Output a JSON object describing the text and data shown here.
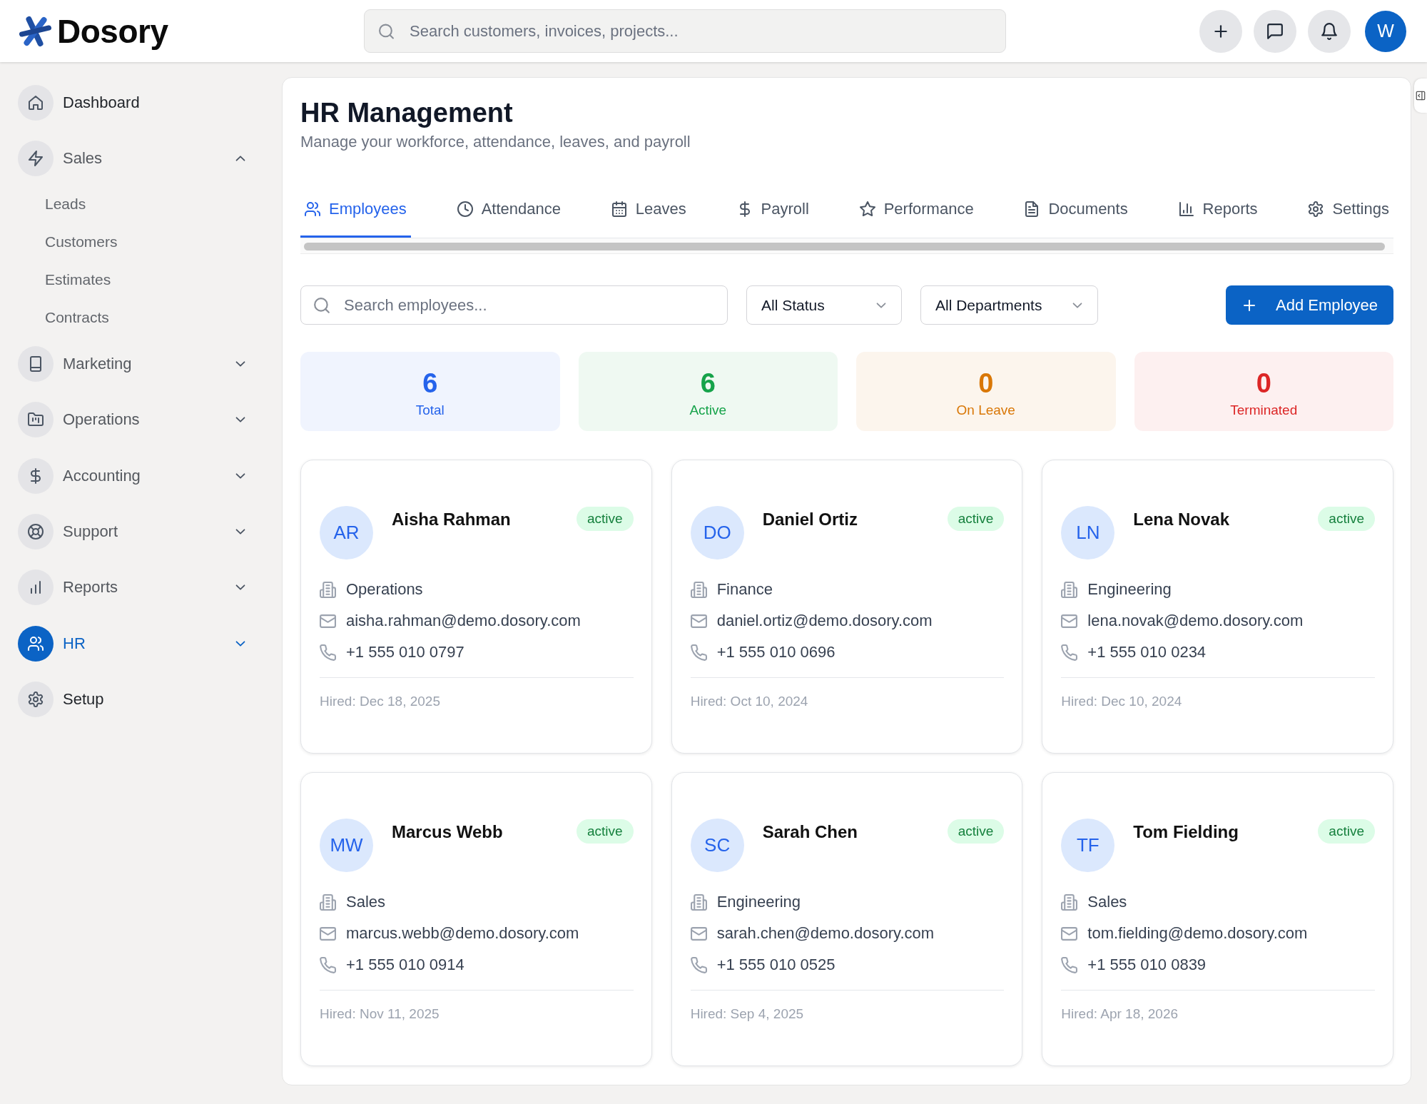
{
  "header": {
    "logo": "Dosory",
    "search": {
      "placeholder": "Search customers, invoices, projects..."
    },
    "user_avatar": "W"
  },
  "sidebar": {
    "items": [
      {
        "kind": "link",
        "label": "Dashboard",
        "selected": false
      },
      {
        "kind": "group",
        "label": "Sales",
        "selected": false,
        "expanded": true,
        "children": [
          {
            "label": "Leads",
            "selected": false
          },
          {
            "label": "Customers",
            "selected": false
          },
          {
            "label": "Estimates",
            "selected": false
          },
          {
            "label": "Contracts",
            "selected": false
          }
        ]
      },
      {
        "kind": "group",
        "label": "Marketing",
        "selected": false,
        "expanded": false
      },
      {
        "kind": "group",
        "label": "Operations",
        "selected": false,
        "expanded": false
      },
      {
        "kind": "group",
        "label": "Accounting",
        "selected": false,
        "expanded": false
      },
      {
        "kind": "group",
        "label": "Support",
        "selected": false,
        "expanded": false
      },
      {
        "kind": "group",
        "label": "Reports",
        "selected": false,
        "expanded": false
      },
      {
        "kind": "group",
        "label": "HR",
        "selected": true,
        "expanded": false
      },
      {
        "kind": "link",
        "label": "Setup",
        "selected": false
      }
    ]
  },
  "page": {
    "title": "HR Management",
    "subtitle": "Manage your workforce, attendance, leaves, and payroll"
  },
  "tabs": [
    {
      "label": "Employees",
      "selected": true
    },
    {
      "label": "Attendance",
      "selected": false
    },
    {
      "label": "Leaves",
      "selected": false
    },
    {
      "label": "Payroll",
      "selected": false
    },
    {
      "label": "Performance",
      "selected": false
    },
    {
      "label": "Documents",
      "selected": false
    },
    {
      "label": "Reports",
      "selected": false
    },
    {
      "label": "Settings",
      "selected": false
    }
  ],
  "filters": {
    "search": {
      "placeholder": "Search employees..."
    },
    "status": "All Status",
    "department": "All Departments",
    "add_button": "Add Employee"
  },
  "stats": [
    {
      "value": "6",
      "label": "Total",
      "color": "#2563eb"
    },
    {
      "value": "6",
      "label": "Active",
      "color": "#16a34a"
    },
    {
      "value": "0",
      "label": "On Leave",
      "color": "#d97706"
    },
    {
      "value": "0",
      "label": "Terminated",
      "color": "#dc2626"
    }
  ],
  "employees": [
    {
      "initials": "AR",
      "name": "Aisha Rahman",
      "status": "active",
      "department": "Operations",
      "email": "aisha.rahman@demo.dosory.com",
      "phone": "+1 555 010 0797",
      "hired": "Hired: Dec 18, 2025"
    },
    {
      "initials": "DO",
      "name": "Daniel Ortiz",
      "status": "active",
      "department": "Finance",
      "email": "daniel.ortiz@demo.dosory.com",
      "phone": "+1 555 010 0696",
      "hired": "Hired: Oct 10, 2024"
    },
    {
      "initials": "LN",
      "name": "Lena Novak",
      "status": "active",
      "department": "Engineering",
      "email": "lena.novak@demo.dosory.com",
      "phone": "+1 555 010 0234",
      "hired": "Hired: Dec 10, 2024"
    },
    {
      "initials": "MW",
      "name": "Marcus Webb",
      "status": "active",
      "department": "Sales",
      "email": "marcus.webb@demo.dosory.com",
      "phone": "+1 555 010 0914",
      "hired": "Hired: Nov 11, 2025"
    },
    {
      "initials": "SC",
      "name": "Sarah Chen",
      "status": "active",
      "department": "Engineering",
      "email": "sarah.chen@demo.dosory.com",
      "phone": "+1 555 010 0525",
      "hired": "Hired: Sep 4, 2025"
    },
    {
      "initials": "TF",
      "name": "Tom Fielding",
      "status": "active",
      "department": "Sales",
      "email": "tom.fielding@demo.dosory.com",
      "phone": "+1 555 010 0839",
      "hired": "Hired: Apr 18, 2026"
    }
  ]
}
